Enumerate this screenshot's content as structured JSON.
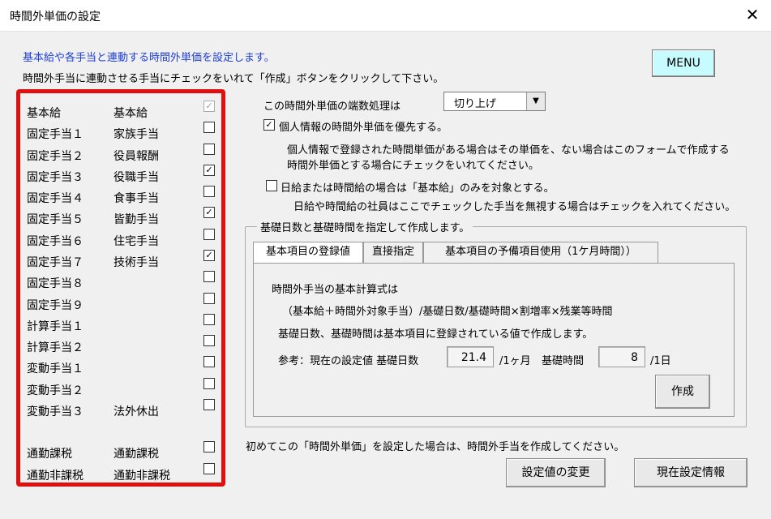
{
  "window": {
    "title": "時間外単価の設定"
  },
  "intro": {
    "line1": "基本給や各手当と連動する時間外単価を設定します。",
    "line2": "時間外手当に連動させる手当にチェックをいれて「作成」ボタンをクリックして下さい。"
  },
  "menu_label": "MENU",
  "allowances": [
    {
      "code": "基本給",
      "name": "基本給",
      "checked": true,
      "disabled": true
    },
    {
      "code": "固定手当１",
      "name": "家族手当",
      "checked": false
    },
    {
      "code": "固定手当２",
      "name": "役員報酬",
      "checked": false
    },
    {
      "code": "固定手当３",
      "name": "役職手当",
      "checked": true
    },
    {
      "code": "固定手当４",
      "name": "食事手当",
      "checked": false
    },
    {
      "code": "固定手当５",
      "name": "皆勤手当",
      "checked": true
    },
    {
      "code": "固定手当６",
      "name": "住宅手当",
      "checked": false
    },
    {
      "code": "固定手当７",
      "name": "技術手当",
      "checked": true
    },
    {
      "code": "固定手当８",
      "name": "",
      "checked": false
    },
    {
      "code": "固定手当９",
      "name": "",
      "checked": false
    },
    {
      "code": "計算手当１",
      "name": "",
      "checked": false
    },
    {
      "code": "計算手当２",
      "name": "",
      "checked": false
    },
    {
      "code": "変動手当１",
      "name": "",
      "checked": false
    },
    {
      "code": "変動手当２",
      "name": "",
      "checked": false
    },
    {
      "code": "変動手当３",
      "name": "法外休出",
      "checked": false
    },
    {
      "code": "通勤課税",
      "name": "通勤課税",
      "checked": false
    },
    {
      "code": "通勤非課税",
      "name": "通勤非課税",
      "checked": false
    }
  ],
  "rounding": {
    "label": "この時間外単価の端数処理は",
    "value": "切り上げ"
  },
  "personal_priority": {
    "label": "個人情報の時間外単価を優先する。",
    "checked": true,
    "note1": "個人情報で登録された時間単価がある場合はその単価を、ない場合はこのフォームで作成する",
    "note2": "時間外単価とする場合にチェックをいれてください。"
  },
  "daily_hourly": {
    "label": "日給または時間給の場合は「基本給」のみを対象とする。",
    "checked": false,
    "note": "日給や時間給の社員はここでチェックした手当を無視する場合はチェックを入れてください。"
  },
  "group": {
    "legend": "基礎日数と基礎時間を指定して作成します。"
  },
  "tabs": [
    "基本項目の登録値",
    "直接指定",
    "基本項目の予備項目使用（1ケ月時間））"
  ],
  "panel": {
    "formula_title": "時間外手当の基本計算式は",
    "formula": "（基本給＋時間外対象手当）/基礎日数/基礎時間×割増率×残業等時間",
    "desc": "基礎日数、基礎時間は基本項目に登録されている値で作成します。",
    "ref_label": "参考：現在の設定値 基礎日数",
    "base_days": "21.4",
    "days_unit": "/1ヶ月",
    "hours_label": "基礎時間",
    "base_hours": "8",
    "hours_unit": "/1日",
    "create_label": "作成"
  },
  "footer": {
    "note": "初めてこの「時間外単価」を設定した場合は、時間外手当を作成してください。",
    "change_label": "設定値の変更",
    "info_label": "現在設定情報"
  }
}
